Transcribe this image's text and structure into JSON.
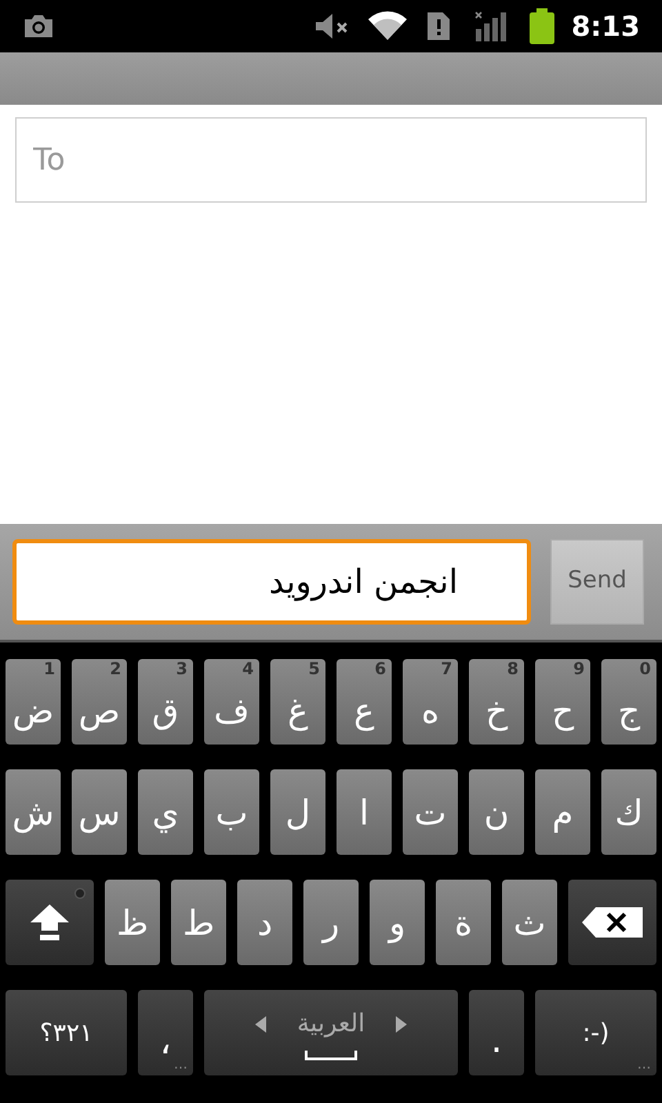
{
  "status_bar": {
    "time": "8:13"
  },
  "recipient": {
    "placeholder": "To"
  },
  "compose": {
    "value": "انجمن اندروید",
    "focused": true,
    "send_label": "Send"
  },
  "keyboard": {
    "number_row": [
      {
        "kind": "letter",
        "label": "ج",
        "hint": "0"
      },
      {
        "kind": "letter",
        "label": "ح",
        "hint": "9"
      },
      {
        "kind": "letter",
        "label": "خ",
        "hint": "8"
      },
      {
        "kind": "letter",
        "label": "ه",
        "hint": "7"
      },
      {
        "kind": "letter",
        "label": "ع",
        "hint": "6"
      },
      {
        "kind": "letter",
        "label": "غ",
        "hint": "5"
      },
      {
        "kind": "letter",
        "label": "ف",
        "hint": "4"
      },
      {
        "kind": "letter",
        "label": "ق",
        "hint": "3"
      },
      {
        "kind": "letter",
        "label": "ص",
        "hint": "2"
      },
      {
        "kind": "letter",
        "label": "ض",
        "hint": "1"
      }
    ],
    "middle_row": [
      {
        "kind": "letter",
        "label": "ك"
      },
      {
        "kind": "letter",
        "label": "م"
      },
      {
        "kind": "letter",
        "label": "ن"
      },
      {
        "kind": "letter",
        "label": "ت"
      },
      {
        "kind": "letter",
        "label": "ا"
      },
      {
        "kind": "letter",
        "label": "ل"
      },
      {
        "kind": "letter",
        "label": "ب"
      },
      {
        "kind": "letter",
        "label": "ي"
      },
      {
        "kind": "letter",
        "label": "س"
      },
      {
        "kind": "letter",
        "label": "ش"
      }
    ],
    "shift_row": [
      {
        "kind": "backspace"
      },
      {
        "kind": "letter",
        "label": "ث"
      },
      {
        "kind": "letter",
        "label": "ة"
      },
      {
        "kind": "letter",
        "label": "و"
      },
      {
        "kind": "letter",
        "label": "ر"
      },
      {
        "kind": "letter",
        "label": "د"
      },
      {
        "kind": "letter",
        "label": "ط"
      },
      {
        "kind": "letter",
        "label": "ظ"
      },
      {
        "kind": "shift"
      }
    ],
    "space_row": [
      {
        "kind": "emoji",
        "label": ":-)",
        "more": "…"
      },
      {
        "kind": "period",
        "label": "."
      },
      {
        "kind": "space",
        "label": "العربية"
      },
      {
        "kind": "comma",
        "label": "،",
        "more": "…"
      },
      {
        "kind": "symbols",
        "label": "٣٢١؟"
      }
    ]
  }
}
